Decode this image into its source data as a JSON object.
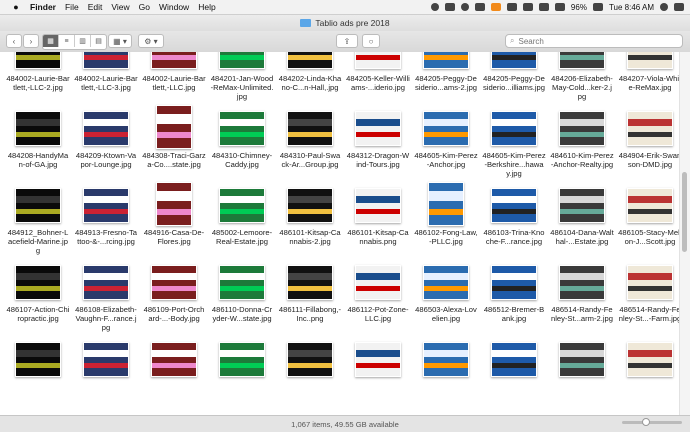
{
  "menubar": {
    "app": "Finder",
    "items": [
      "File",
      "Edit",
      "View",
      "Go",
      "Window",
      "Help"
    ],
    "battery": "96%",
    "clock": "Tue 8:46 AM"
  },
  "window": {
    "title": "Tablio ads pre 2018"
  },
  "toolbar": {
    "back": "‹",
    "forward": "›",
    "view_modes": [
      "▦",
      "≡",
      "▥",
      "▤"
    ],
    "group": "▦ ▾",
    "action": "⚙ ▾",
    "share": "⇪",
    "tags": "○",
    "trash": "🗑",
    "search_placeholder": "Search"
  },
  "files": [
    "484002-Laurie-Bartlett,-LLC-2.jpg",
    "484002-Laurie-Bartlett,-LLC-3.jpg",
    "484002-Laurie-Bartlett,-LLC.jpg",
    "484201-Jan-Wood-ReMax-Unlimited.jpg",
    "484202-Linda-Khano-C...n-Hall,.jpg",
    "484205-Keller-Williams-...iderio.jpg",
    "484205-Peggy-Desiderio...ams-2.jpg",
    "484205-Peggy-Desiderio...illiams.jpg",
    "484206-Elizabeth-May-Cold...ker-2.jpg",
    "484207-Viola-White-ReMax.jpg",
    "484208-HandyMan-of-GA.jpg",
    "484209-Ktown-Vapor-Lounge.jpg",
    "484308-Traci-Garza-Co....state.jpg",
    "484310-Chimney-Caddy.jpg",
    "484310-Paul-Swack-Ar...Group.jpg",
    "484312-Dragon-Wind-Tours.jpg",
    "484605-Kim-Perez-Anchor.jpg",
    "484605-Kim-Perez-Berkshire...haway.jpg",
    "484610-Kim-Perez-Anchor-Realty.jpg",
    "484904-Erik-Swanson-DMD.jpg",
    "484912_Bohner-Lacefield-Marine.jpg",
    "484913-Fresno-Tattoo-&-...rcing.jpg",
    "484916-Casa-De-Flores.jpg",
    "485002-Lemoore-Real-Estate.jpg",
    "486101-Kitsap-Cannabis-2.jpg",
    "486101-Kitsap-Cannabis.png",
    "486102-Fong-Law,-PLLC.jpg",
    "486103-Trina-Knoche-F...rance.jpg",
    "486104-Dana-Walthal-...Estate.jpg",
    "486105-Stacy-Melton-J...Scott.jpg",
    "486107-Action-Chiropractic.jpg",
    "486108-Elizabeth-Vaughn-F...rance.jpg",
    "486109-Port-Orchard-...-Body.jpg",
    "486110-Donna-Cryder-W...state.jpg",
    "486111-Fillabong,-Inc..png",
    "486112-Pot-Zone-LLC.jpg",
    "486503-Alexa-Lovelien.jpg",
    "486512-Bremer-Bank.jpg",
    "486514-Randy-Fenley-St...arm-2.jpg",
    "486514-Randy-Fenley-St...-Farm.jpg",
    "",
    "",
    "",
    "",
    "",
    "",
    "",
    "",
    "",
    ""
  ],
  "status": {
    "text": "1,067 items, 49.55 GB available"
  }
}
